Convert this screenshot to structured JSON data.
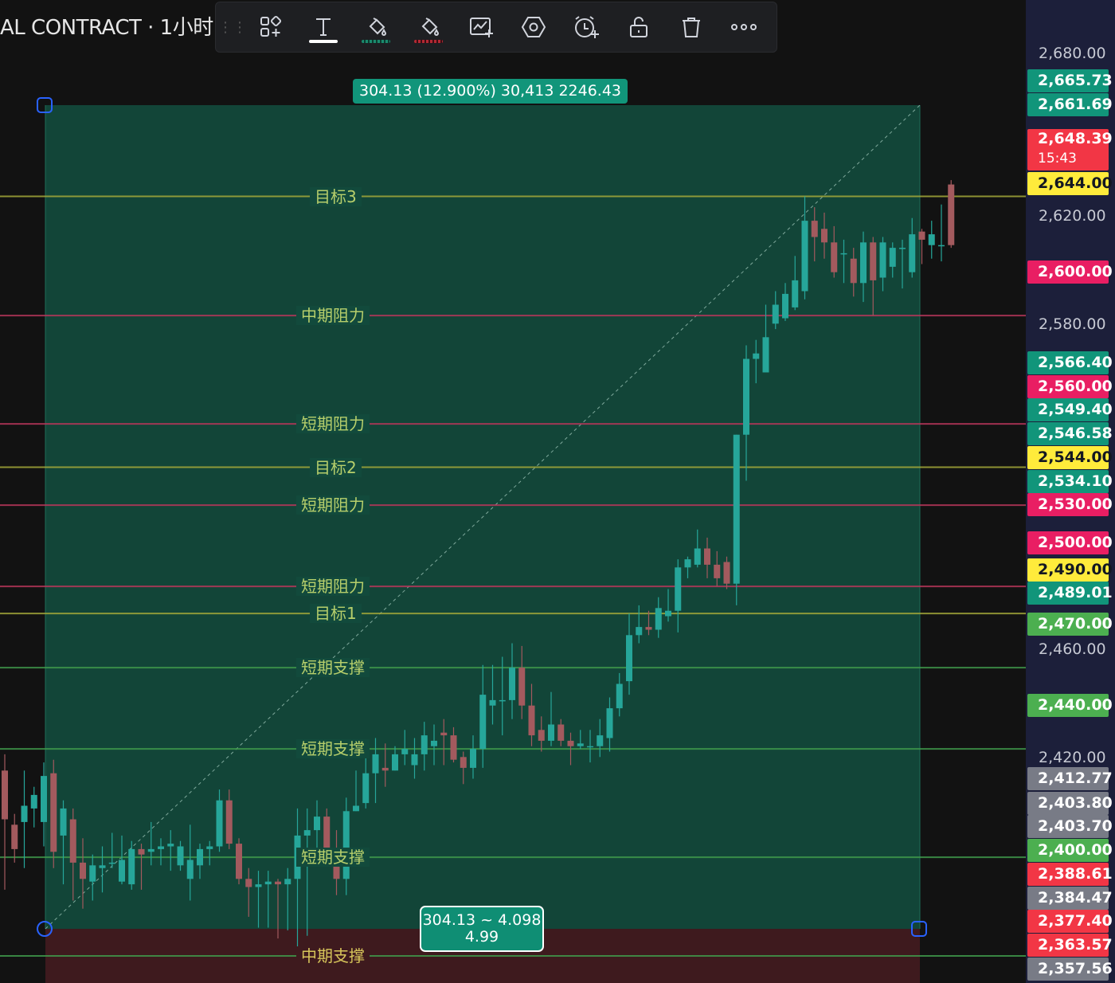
{
  "header": {
    "title": "AL CONTRACT · 1小时 ·"
  },
  "toolbar": {
    "buttons": [
      {
        "name": "templates-icon"
      },
      {
        "name": "text-icon",
        "underline": "#ffffff"
      },
      {
        "name": "fill-color-icon",
        "underline": "#1b8a6e"
      },
      {
        "name": "line-color-icon",
        "underline": "#b22833"
      },
      {
        "name": "add-alert-chart-icon"
      },
      {
        "name": "settings-hexagon-icon"
      },
      {
        "name": "alarm-add-icon"
      },
      {
        "name": "lock-icon"
      },
      {
        "name": "trash-icon"
      },
      {
        "name": "more-icon"
      }
    ]
  },
  "measure": {
    "top_label": "304.13 (12.900%) 30,413 2246.43",
    "bottom_line1": "304.13 ~ 4.098",
    "bottom_line2": "4.99"
  },
  "colors": {
    "up": "#26a69a",
    "down": "#a35a5e",
    "target_line": "#a3a83a",
    "resistance_line": "#b8365a",
    "support_line": "#3f9a4b",
    "profit_zone": "#124a3c",
    "loss_zone": "#3e1a1e"
  },
  "axis": {
    "ticks": [
      "2,680.00",
      "2,620.00",
      "2,580.00",
      "2,460.00",
      "2,420.00"
    ]
  },
  "price_badges": [
    {
      "text": "2,665.73",
      "bg": "#11957a"
    },
    {
      "text": "2,661.69",
      "bg": "#11957a"
    },
    {
      "text": "2,648.39",
      "sub": "15:43",
      "bg": "#f23645"
    },
    {
      "text": "2,644.00",
      "bg": "#ffeb3b",
      "fg": "#131722"
    },
    {
      "text": "2,600.00",
      "bg": "#e91e63"
    },
    {
      "text": "2,566.40",
      "bg": "#11957a"
    },
    {
      "text": "2,560.00",
      "bg": "#e91e63"
    },
    {
      "text": "2,549.40",
      "bg": "#11957a"
    },
    {
      "text": "2,546.58",
      "bg": "#11957a"
    },
    {
      "text": "2,544.00",
      "bg": "#ffeb3b",
      "fg": "#131722"
    },
    {
      "text": "2,534.10",
      "bg": "#11957a"
    },
    {
      "text": "2,530.00",
      "bg": "#e91e63"
    },
    {
      "text": "2,500.00",
      "bg": "#e91e63"
    },
    {
      "text": "2,490.00",
      "bg": "#ffeb3b",
      "fg": "#131722"
    },
    {
      "text": "2,489.01",
      "bg": "#11957a"
    },
    {
      "text": "2,470.00",
      "bg": "#4caf50"
    },
    {
      "text": "2,440.00",
      "bg": "#4caf50"
    },
    {
      "text": "2,412.77",
      "bg": "#787b86"
    },
    {
      "text": "2,403.80",
      "bg": "#787b86"
    },
    {
      "text": "2,403.70",
      "bg": "#787b86"
    },
    {
      "text": "2,400.00",
      "bg": "#4caf50"
    },
    {
      "text": "2,388.61",
      "bg": "#f23645"
    },
    {
      "text": "2,384.47",
      "bg": "#787b86"
    },
    {
      "text": "2,377.40",
      "bg": "#f23645"
    },
    {
      "text": "2,363.57",
      "bg": "#f23645"
    },
    {
      "text": "2,357.56",
      "bg": "#787b86"
    }
  ],
  "levels": [
    {
      "label": "目标3",
      "price": 2644,
      "kind": "target"
    },
    {
      "label": "中期阻力",
      "price": 2600,
      "kind": "resistance"
    },
    {
      "label": "短期阻力",
      "price": 2560,
      "kind": "resistance"
    },
    {
      "label": "目标2",
      "price": 2544,
      "kind": "target"
    },
    {
      "label": "短期阻力",
      "price": 2530,
      "kind": "resistance"
    },
    {
      "label": "短期阻力",
      "price": 2500,
      "kind": "resistance"
    },
    {
      "label": "目标1",
      "price": 2490,
      "kind": "target"
    },
    {
      "label": "短期支撑",
      "price": 2470,
      "kind": "support"
    },
    {
      "label": "短期支撑",
      "price": 2440,
      "kind": "support"
    },
    {
      "label": "短期支撑",
      "price": 2400,
      "kind": "support"
    },
    {
      "label": "中期支撑",
      "price": 2363.57,
      "kind": "support_mid"
    }
  ],
  "chart_data": {
    "type": "candlestick",
    "timeframe": "1小时",
    "y_range": [
      2352,
      2685
    ],
    "position": {
      "entry": 2344.1,
      "target": 2648.23,
      "stop": 2340
    },
    "candles": [
      [
        2432,
        2414,
        2438,
        2388
      ],
      [
        2412,
        2403,
        2416,
        2398
      ],
      [
        2413,
        2419,
        2432,
        2396
      ],
      [
        2418,
        2423,
        2426,
        2411
      ],
      [
        2413,
        2430,
        2435,
        2404
      ],
      [
        2431,
        2402,
        2436,
        2396
      ],
      [
        2408,
        2418,
        2421,
        2390
      ],
      [
        2414,
        2398,
        2418,
        2384
      ],
      [
        2398,
        2392,
        2407,
        2381
      ],
      [
        2391,
        2397,
        2401,
        2384
      ],
      [
        2396,
        2397,
        2404,
        2387
      ],
      [
        2398,
        2398,
        2409,
        2396
      ],
      [
        2391,
        2399,
        2408,
        2390
      ],
      [
        2390,
        2403,
        2406,
        2388
      ],
      [
        2403,
        2401,
        2405,
        2388
      ],
      [
        2402,
        2403,
        2413,
        2397
      ],
      [
        2403,
        2404,
        2407,
        2397
      ],
      [
        2404,
        2405,
        2410,
        2395
      ],
      [
        2397,
        2404,
        2406,
        2395
      ],
      [
        2392,
        2399,
        2412,
        2384
      ],
      [
        2397,
        2403,
        2405,
        2392
      ],
      [
        2403,
        2404,
        2406,
        2397
      ],
      [
        2404,
        2421,
        2425,
        2402
      ],
      [
        2421,
        2405,
        2425,
        2403
      ],
      [
        2405,
        2392,
        2407,
        2390
      ],
      [
        2392,
        2389,
        2396,
        2378
      ],
      [
        2389,
        2390,
        2395,
        2374
      ],
      [
        2390,
        2391,
        2395,
        2374
      ],
      [
        2391,
        2390,
        2392,
        2370
      ],
      [
        2390,
        2392,
        2396,
        2373
      ],
      [
        2392,
        2408,
        2418,
        2367
      ],
      [
        2408,
        2410,
        2418,
        2371
      ],
      [
        2410,
        2415,
        2421,
        2402
      ],
      [
        2415,
        2401,
        2418,
        2397
      ],
      [
        2400,
        2392,
        2410,
        2386
      ],
      [
        2392,
        2417,
        2422,
        2386
      ],
      [
        2417,
        2419,
        2432,
        2417
      ],
      [
        2420,
        2431,
        2439,
        2418
      ],
      [
        2431,
        2438,
        2444,
        2420
      ],
      [
        2433,
        2432,
        2442,
        2426
      ],
      [
        2432,
        2438,
        2441,
        2432
      ],
      [
        2438,
        2440,
        2447,
        2434
      ],
      [
        2434,
        2438,
        2444,
        2429
      ],
      [
        2438,
        2445,
        2450,
        2432
      ],
      [
        2441,
        2443,
        2449,
        2434
      ],
      [
        2446,
        2445,
        2451,
        2434
      ],
      [
        2445,
        2436,
        2448,
        2435
      ],
      [
        2437,
        2433,
        2439,
        2427
      ],
      [
        2433,
        2440,
        2445,
        2429
      ],
      [
        2440,
        2460,
        2471,
        2433
      ],
      [
        2456,
        2458,
        2471,
        2449
      ],
      [
        2458,
        2458,
        2474,
        2445
      ],
      [
        2458,
        2470,
        2479,
        2451
      ],
      [
        2470,
        2456,
        2478,
        2451
      ],
      [
        2456,
        2445,
        2464,
        2441
      ],
      [
        2447,
        2443,
        2452,
        2439
      ],
      [
        2443,
        2449,
        2461,
        2441
      ],
      [
        2449,
        2443,
        2451,
        2441
      ],
      [
        2443,
        2441,
        2446,
        2434
      ],
      [
        2441,
        2442,
        2447,
        2440
      ],
      [
        2441,
        2441,
        2447,
        2435
      ],
      [
        2441,
        2445,
        2451,
        2437
      ],
      [
        2444,
        2455,
        2459,
        2439
      ],
      [
        2455,
        2464,
        2468,
        2452
      ],
      [
        2465,
        2482,
        2490,
        2460
      ],
      [
        2482,
        2485,
        2493,
        2479
      ],
      [
        2485,
        2484,
        2491,
        2482
      ],
      [
        2484,
        2492,
        2496,
        2481
      ],
      [
        2489,
        2491,
        2499,
        2487
      ],
      [
        2491,
        2507,
        2510,
        2483
      ],
      [
        2507,
        2510,
        2511,
        2503
      ],
      [
        2508,
        2514,
        2521,
        2507
      ],
      [
        2514,
        2508,
        2518,
        2503
      ],
      [
        2508,
        2503,
        2513,
        2500
      ],
      [
        2509,
        2501,
        2511,
        2499
      ],
      [
        2501,
        2556,
        2556,
        2493
      ],
      [
        2556,
        2584,
        2589,
        2539
      ],
      [
        2584,
        2586,
        2591,
        2575
      ],
      [
        2579,
        2592,
        2604,
        2580
      ],
      [
        2597,
        2604,
        2609,
        2595
      ],
      [
        2599,
        2608,
        2612,
        2598
      ],
      [
        2603,
        2613,
        2622,
        2602
      ],
      [
        2609,
        2635,
        2644,
        2606
      ],
      [
        2635,
        2629,
        2640,
        2620
      ],
      [
        2632,
        2627,
        2638,
        2621
      ],
      [
        2627,
        2616,
        2633,
        2614
      ],
      [
        2623,
        2623,
        2628,
        2612
      ],
      [
        2621,
        2612,
        2625,
        2607
      ],
      [
        2612,
        2627,
        2631,
        2605
      ],
      [
        2627,
        2613,
        2629,
        2600
      ],
      [
        2614,
        2627,
        2629,
        2609
      ],
      [
        2618,
        2625,
        2627,
        2614
      ],
      [
        2625,
        2625,
        2628,
        2610
      ],
      [
        2616,
        2630,
        2636,
        2614
      ],
      [
        2631,
        2628,
        2632,
        2619
      ],
      [
        2626,
        2630,
        2635,
        2621
      ],
      [
        2626,
        2626,
        2641,
        2620
      ],
      [
        2648.39,
        2626,
        2650,
        2625
      ]
    ],
    "candle_format": "[open, close, high, low]"
  }
}
